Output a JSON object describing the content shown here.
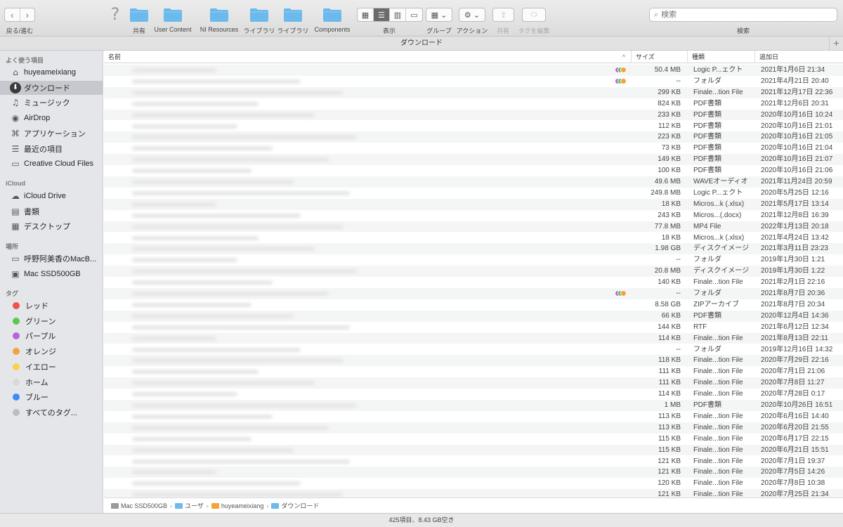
{
  "toolbar": {
    "nav_label": "戻る/進む",
    "back_icon": "‹",
    "forward_icon": "›",
    "help_icon": "?",
    "items": [
      {
        "label": "共有"
      },
      {
        "label": "User Content"
      },
      {
        "label": "NI Resources"
      },
      {
        "label": "ライブラリ"
      },
      {
        "label": "ライブラリ"
      },
      {
        "label": "Components"
      }
    ],
    "view_label": "表示",
    "group_label": "グループ",
    "action_label": "アクション",
    "share_label": "共有",
    "tags_label": "タグを編集",
    "search_label": "検索",
    "search_placeholder": "検索",
    "folder_color": "#6cb9ec"
  },
  "window": {
    "title": "ダウンロード",
    "plus_icon": "+"
  },
  "sidebar": {
    "favorites_header": "よく使う項目",
    "favorites": [
      {
        "label": "huyeamei​xiang",
        "icon": "⌂",
        "icon_name": "home-icon"
      },
      {
        "label": "ダウンロード",
        "icon": "⬇",
        "icon_name": "download-icon",
        "selected": true
      },
      {
        "label": "ミュージック",
        "icon": "♫",
        "icon_name": "music-icon"
      },
      {
        "label": "AirDrop",
        "icon": "◉",
        "icon_name": "airdrop-icon"
      },
      {
        "label": "アプリケーション",
        "icon": "⌘",
        "icon_name": "applications-icon"
      },
      {
        "label": "最近の項目",
        "icon": "☰",
        "icon_name": "recents-icon"
      },
      {
        "label": "Creative Cloud Files",
        "icon": "▭",
        "icon_name": "folder-icon"
      }
    ],
    "icloud_header": "iCloud",
    "icloud": [
      {
        "label": "iCloud Drive",
        "icon": "☁",
        "icon_name": "cloud-icon"
      },
      {
        "label": "書類",
        "icon": "▤",
        "icon_name": "documents-icon"
      },
      {
        "label": "デスクトップ",
        "icon": "▦",
        "icon_name": "desktop-icon"
      }
    ],
    "locations_header": "場所",
    "locations": [
      {
        "label": "呼野阿美香のMacB...",
        "icon": "▭",
        "icon_name": "laptop-icon"
      },
      {
        "label": "Mac SSD500GB",
        "icon": "▣",
        "icon_name": "disk-icon"
      }
    ],
    "tags_header": "タグ",
    "tags": [
      {
        "label": "レッド",
        "color": "#f0524f"
      },
      {
        "label": "グリーン",
        "color": "#5ac84f"
      },
      {
        "label": "パープル",
        "color": "#b566d9"
      },
      {
        "label": "オレンジ",
        "color": "#f6a043"
      },
      {
        "label": "イエロー",
        "color": "#f8d24a"
      },
      {
        "label": "ホーム",
        "color": "#d9d9d9"
      },
      {
        "label": "ブルー",
        "color": "#3d8bf7"
      },
      {
        "label": "すべてのタグ...",
        "color": "#bdbdbd"
      }
    ]
  },
  "columns": {
    "name": "名前",
    "size": "サイズ",
    "kind": "種類",
    "date": "追加日",
    "sort_icon": "^"
  },
  "tag_colors": [
    "#b566d9",
    "#5ac84f",
    "#f6a043"
  ],
  "files": [
    {
      "size": "50.4 MB",
      "kind": "Logic P...ェクト",
      "date": "2021年1月6日 21:34",
      "tags": true
    },
    {
      "size": "--",
      "kind": "フォルダ",
      "date": "2021年4月21日 20:40",
      "tags": true
    },
    {
      "size": "299 KB",
      "kind": "Finale...tion File",
      "date": "2021年12月17日 22:36"
    },
    {
      "size": "824 KB",
      "kind": "PDF書類",
      "date": "2021年12月6日 20:31"
    },
    {
      "size": "233 KB",
      "kind": "PDF書類",
      "date": "2020年10月16日 10:24"
    },
    {
      "size": "112 KB",
      "kind": "PDF書類",
      "date": "2020年10月16日 21:01"
    },
    {
      "size": "223 KB",
      "kind": "PDF書類",
      "date": "2020年10月16日 21:05"
    },
    {
      "size": "73 KB",
      "kind": "PDF書類",
      "date": "2020年10月16日 21:04"
    },
    {
      "size": "149 KB",
      "kind": "PDF書類",
      "date": "2020年10月16日 21:07"
    },
    {
      "size": "100 KB",
      "kind": "PDF書類",
      "date": "2020年10月16日 21:06"
    },
    {
      "size": "49.6 MB",
      "kind": "WAVEオーディオ",
      "date": "2021年11月24日 20:59"
    },
    {
      "size": "249.8 MB",
      "kind": "Logic P...ェクト",
      "date": "2020年5月25日 12:16"
    },
    {
      "size": "18 KB",
      "kind": "Micros...k (.xlsx)",
      "date": "2021年5月17日 13:14"
    },
    {
      "size": "243 KB",
      "kind": "Micros...(.docx)",
      "date": "2021年12月8日 16:39"
    },
    {
      "size": "77.8 MB",
      "kind": "MP4 File",
      "date": "2022年1月13日 20:18"
    },
    {
      "size": "18 KB",
      "kind": "Micros...k (.xlsx)",
      "date": "2021年4月24日 13:42"
    },
    {
      "size": "1.98 GB",
      "kind": "ディスクイメージ",
      "date": "2021年3月11日 23:23"
    },
    {
      "size": "--",
      "kind": "フォルダ",
      "date": "2019年1月30日 1:21"
    },
    {
      "size": "20.8 MB",
      "kind": "ディスクイメージ",
      "date": "2019年1月30日 1:22"
    },
    {
      "size": "140 KB",
      "kind": "Finale...tion File",
      "date": "2021年2月1日 22:16"
    },
    {
      "size": "--",
      "kind": "フォルダ",
      "date": "2021年8月7日 20:36",
      "tags": true
    },
    {
      "size": "8.58 GB",
      "kind": "ZIPアーカイブ",
      "date": "2021年8月7日 20:34"
    },
    {
      "size": "66 KB",
      "kind": "PDF書類",
      "date": "2020年12月4日 14:36"
    },
    {
      "size": "144 KB",
      "kind": "RTF",
      "date": "2021年6月12日 12:34"
    },
    {
      "size": "114 KB",
      "kind": "Finale...tion File",
      "date": "2021年8月13日 22:11"
    },
    {
      "size": "--",
      "kind": "フォルダ",
      "date": "2019年12月16日 14:32"
    },
    {
      "size": "118 KB",
      "kind": "Finale...tion File",
      "date": "2020年7月29日 22:16"
    },
    {
      "size": "111 KB",
      "kind": "Finale...tion File",
      "date": "2020年7月1日 21:06"
    },
    {
      "size": "111 KB",
      "kind": "Finale...tion File",
      "date": "2020年7月8日 11:27"
    },
    {
      "size": "114 KB",
      "kind": "Finale...tion File",
      "date": "2020年7月28日 0:17"
    },
    {
      "size": "1 MB",
      "kind": "PDF書類",
      "date": "2020年10月26日 16:51"
    },
    {
      "size": "113 KB",
      "kind": "Finale...tion File",
      "date": "2020年6月16日 14:40"
    },
    {
      "size": "113 KB",
      "kind": "Finale...tion File",
      "date": "2020年6月20日 21:55"
    },
    {
      "size": "115 KB",
      "kind": "Finale...tion File",
      "date": "2020年6月17日 22:15"
    },
    {
      "size": "115 KB",
      "kind": "Finale...tion File",
      "date": "2020年6月21日 15:51"
    },
    {
      "size": "121 KB",
      "kind": "Finale...tion File",
      "date": "2020年7月1日 19:37"
    },
    {
      "size": "121 KB",
      "kind": "Finale...tion File",
      "date": "2020年7月5日 14:26"
    },
    {
      "size": "120 KB",
      "kind": "Finale...tion File",
      "date": "2020年7月8日 10:38"
    },
    {
      "size": "121 KB",
      "kind": "Finale...tion File",
      "date": "2020年7月25日 21:34"
    }
  ],
  "pathbar": {
    "segments": [
      {
        "label": "Mac SSD500GB",
        "color": "#9a9a9a"
      },
      {
        "label": "ユーザ",
        "color": "#6cb9ec"
      },
      {
        "label": "huyeamei​xiang",
        "color": "#f2a33a"
      },
      {
        "label": "ダウンロード",
        "color": "#6cb9ec"
      }
    ],
    "separator": "›"
  },
  "status": "425項目、8.43 GB空き"
}
